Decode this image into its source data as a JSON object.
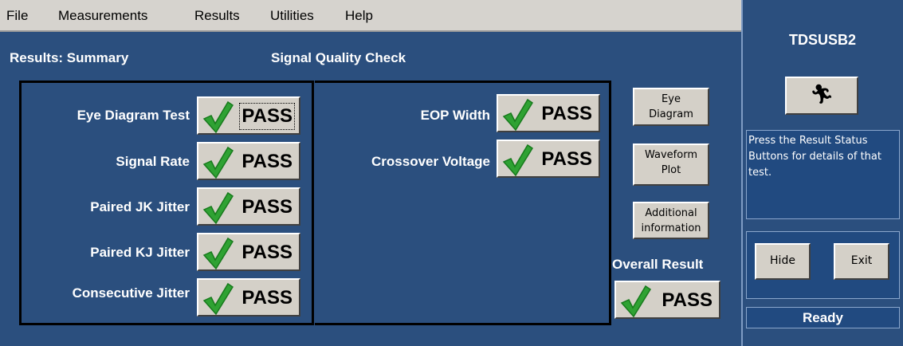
{
  "menu": {
    "items": [
      {
        "label": "File"
      },
      {
        "label": "Measurements"
      },
      {
        "label": "Results"
      },
      {
        "label": "Utilities"
      },
      {
        "label": "Help"
      }
    ]
  },
  "header": {
    "results_title": "Results: Summary",
    "check_title": "Signal Quality Check"
  },
  "tests_left": [
    {
      "label": "Eye Diagram Test",
      "result": "PASS"
    },
    {
      "label": "Signal Rate",
      "result": "PASS"
    },
    {
      "label": "Paired JK Jitter",
      "result": "PASS"
    },
    {
      "label": "Paired KJ Jitter",
      "result": "PASS"
    },
    {
      "label": "Consecutive Jitter",
      "result": "PASS"
    }
  ],
  "tests_right": [
    {
      "label": "EOP Width",
      "result": "PASS"
    },
    {
      "label": "Crossover Voltage",
      "result": "PASS"
    }
  ],
  "side_buttons": {
    "eye_diagram": [
      "Eye",
      "Diagram"
    ],
    "waveform_plot": [
      "Waveform",
      "Plot"
    ],
    "additional_info": [
      "Additional",
      "information"
    ]
  },
  "overall": {
    "label": "Overall Result",
    "result": "PASS"
  },
  "sidebar": {
    "app_title": "TDSUSB2",
    "run_icon": "running-man-icon",
    "info_text": "Press the Result Status Buttons for details of that test.",
    "hide_label": "Hide",
    "exit_label": "Exit",
    "status": "Ready"
  },
  "colors": {
    "background": "#2b4f7e",
    "menubar": "#d6d3ce",
    "button_face": "#d4d0c8",
    "check_green": "#2fa233"
  }
}
